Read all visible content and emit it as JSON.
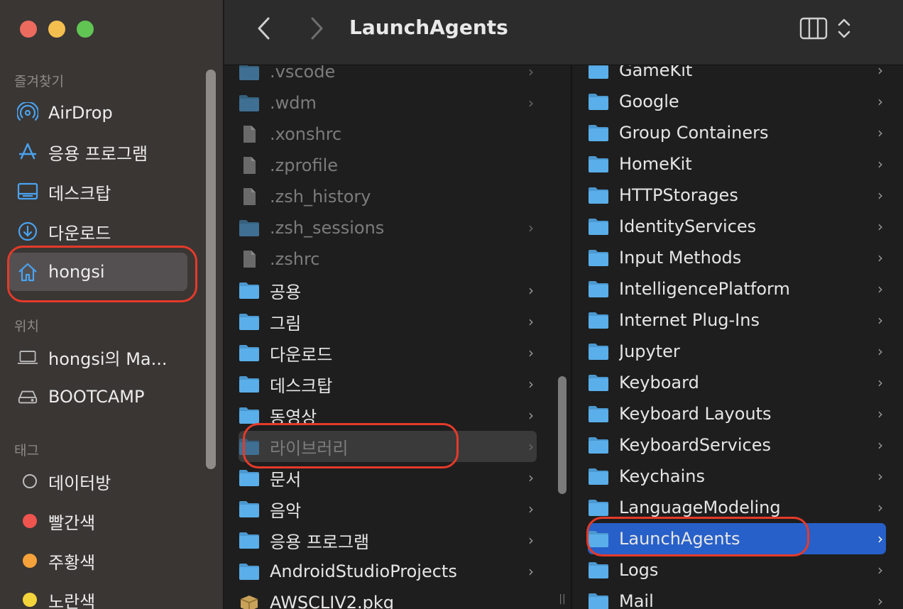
{
  "window": {
    "title": "LaunchAgents"
  },
  "sidebar": {
    "favorites_title": "즐겨찾기",
    "favorites": [
      {
        "label": "AirDrop",
        "icon": "airdrop-icon"
      },
      {
        "label": "응용 프로그램",
        "icon": "applications-icon"
      },
      {
        "label": "데스크탑",
        "icon": "desktop-icon"
      },
      {
        "label": "다운로드",
        "icon": "download-icon"
      },
      {
        "label": "hongsi",
        "icon": "home-icon",
        "selected": true
      }
    ],
    "locations_title": "위치",
    "locations": [
      {
        "label": "hongsi의 Ma...",
        "icon": "laptop-icon"
      },
      {
        "label": "BOOTCAMP",
        "icon": "drive-icon"
      }
    ],
    "tags_title": "태그",
    "tags": [
      {
        "label": "데이터방",
        "color": "none"
      },
      {
        "label": "빨간색",
        "color": "#f0544f"
      },
      {
        "label": "주황색",
        "color": "#f5a23a"
      },
      {
        "label": "노란색",
        "color": "#f4d43b"
      }
    ]
  },
  "column1": {
    "items": [
      {
        "label": ".vscode",
        "type": "folder",
        "dim": true,
        "chevron": true
      },
      {
        "label": ".wdm",
        "type": "folder",
        "dim": true,
        "chevron": true
      },
      {
        "label": ".xonshrc",
        "type": "file",
        "dim": true,
        "chevron": false
      },
      {
        "label": ".zprofile",
        "type": "file",
        "dim": true,
        "chevron": false
      },
      {
        "label": ".zsh_history",
        "type": "file",
        "dim": true,
        "chevron": false
      },
      {
        "label": ".zsh_sessions",
        "type": "folder",
        "dim": true,
        "chevron": true
      },
      {
        "label": ".zshrc",
        "type": "file",
        "dim": true,
        "chevron": false
      },
      {
        "label": "공용",
        "type": "folder",
        "dim": false,
        "chevron": true
      },
      {
        "label": "그림",
        "type": "folder",
        "dim": false,
        "chevron": true
      },
      {
        "label": "다운로드",
        "type": "folder",
        "dim": false,
        "chevron": true
      },
      {
        "label": "데스크탑",
        "type": "folder",
        "dim": false,
        "chevron": true
      },
      {
        "label": "동영상",
        "type": "folder",
        "dim": false,
        "chevron": true
      },
      {
        "label": "라이브러리",
        "type": "folder",
        "dim": true,
        "chevron": true,
        "selected": true
      },
      {
        "label": "문서",
        "type": "folder",
        "dim": false,
        "chevron": true
      },
      {
        "label": "음악",
        "type": "folder",
        "dim": false,
        "chevron": true
      },
      {
        "label": "응용 프로그램",
        "type": "folder",
        "dim": false,
        "chevron": true
      },
      {
        "label": "AndroidStudioProjects",
        "type": "folder",
        "dim": false,
        "chevron": true
      },
      {
        "label": "AWSCLIV2.pkg",
        "type": "package",
        "dim": false,
        "chevron": false
      }
    ]
  },
  "column2": {
    "items": [
      {
        "label": "GameKit"
      },
      {
        "label": "Google"
      },
      {
        "label": "Group Containers"
      },
      {
        "label": "HomeKit"
      },
      {
        "label": "HTTPStorages"
      },
      {
        "label": "IdentityServices"
      },
      {
        "label": "Input Methods"
      },
      {
        "label": "IntelligencePlatform"
      },
      {
        "label": "Internet Plug-Ins"
      },
      {
        "label": "Jupyter"
      },
      {
        "label": "Keyboard"
      },
      {
        "label": "Keyboard Layouts"
      },
      {
        "label": "KeyboardServices"
      },
      {
        "label": "Keychains"
      },
      {
        "label": "LanguageModeling"
      },
      {
        "label": "LaunchAgents",
        "selected": true
      },
      {
        "label": "Logs"
      },
      {
        "label": "Mail"
      }
    ]
  },
  "colors": {
    "accent": "#2760c9",
    "annotation": "#e53a2a",
    "folder": "#5aaee9"
  }
}
